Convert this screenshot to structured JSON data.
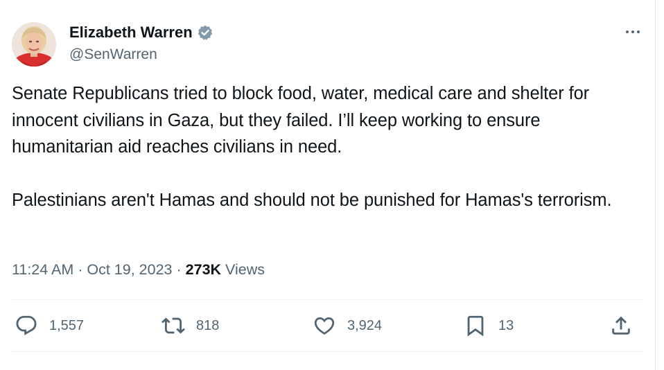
{
  "author": {
    "display_name": "Elizabeth Warren",
    "handle": "@SenWarren",
    "verified": true,
    "verified_color": "#829aab"
  },
  "tweet": {
    "paragraphs": [
      "Senate Republicans tried to block food, water, medical care and shelter for innocent civilians in Gaza, but they failed. I’ll keep working to ensure humanitarian aid reaches civilians in need.",
      "Palestinians aren't Hamas and should not be punished for Hamas's terrorism."
    ]
  },
  "meta": {
    "time": "11:24 AM",
    "separator": "·",
    "date": "Oct 19, 2023",
    "views_count": "273K",
    "views_label": "Views"
  },
  "actions": {
    "reply": {
      "icon": "reply-icon",
      "count": "1,557"
    },
    "retweet": {
      "icon": "retweet-icon",
      "count": "818"
    },
    "like": {
      "icon": "heart-icon",
      "count": "3,924"
    },
    "bookmark": {
      "icon": "bookmark-icon",
      "count": "13"
    },
    "share": {
      "icon": "share-icon"
    }
  },
  "colors": {
    "text": "#0f1419",
    "secondary": "#536471",
    "divider": "#eff3f4"
  }
}
